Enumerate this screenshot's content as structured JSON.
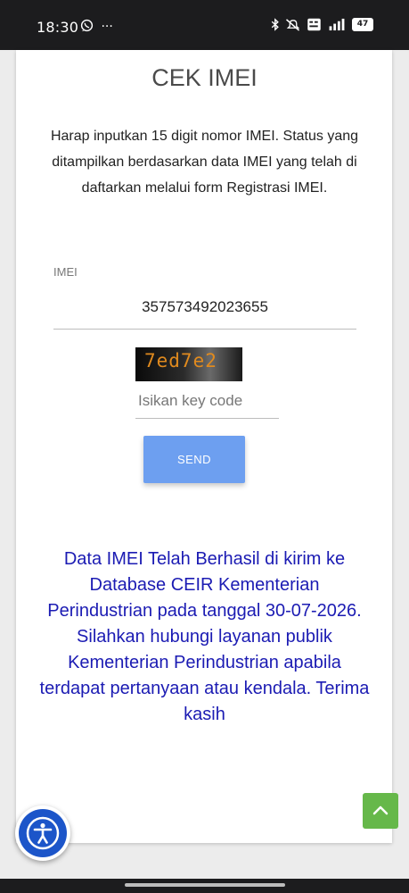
{
  "status_bar": {
    "time": "18:30",
    "left_icons": [
      "whatsapp-icon",
      "more-icon"
    ],
    "right_icons": [
      "bluetooth-icon",
      "mute-icon",
      "volte-icon",
      "signal-icon"
    ],
    "battery": "47"
  },
  "page": {
    "title": "CEK IMEI",
    "instructions": "Harap inputkan 15 digit nomor IMEI. Status yang ditampilkan berdasarkan data IMEI yang telah di daftarkan melalui form Registrasi IMEI."
  },
  "form": {
    "imei_label": "IMEI",
    "imei_value": "357573492023655",
    "captcha_text": "7ed7e2",
    "keycode_placeholder": "Isikan key code",
    "send_label": "SEND"
  },
  "result": {
    "line1": "Data IMEI Telah Berhasil di kirim ke Database CEIR Kementerian Perindustrian pada tanggal 30-07-2026.",
    "line2": "Silahkan hubungi layanan publik Kementerian Perindustrian apabila terdapat pertanyaan atau kendala. Terima kasih"
  },
  "colors": {
    "send_button": "#6d9ff0",
    "result_text": "#1b1bb3",
    "scroll_top_button": "#66b84a",
    "accessibility_button": "#1c55c9"
  }
}
